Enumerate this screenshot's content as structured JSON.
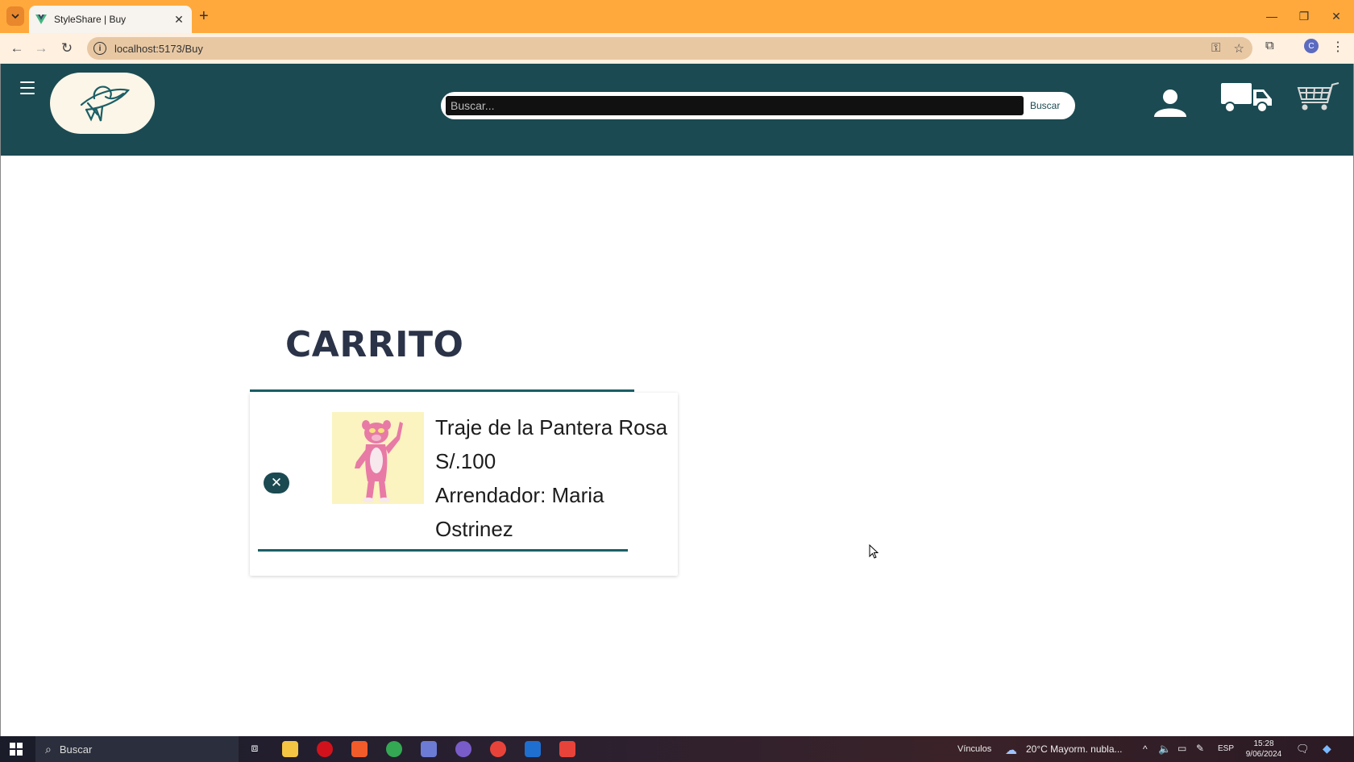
{
  "browser": {
    "tab_title": "StyleShare | Buy",
    "url": "localhost:5173/Buy",
    "profile_initial": "C"
  },
  "header": {
    "search_placeholder": "Buscar...",
    "search_button": "Buscar"
  },
  "cart": {
    "title": "CARRITO",
    "items": [
      {
        "name": "Traje de la Pantera Rosa",
        "price": "S/.100",
        "owner_line": "Arrendador: Maria Ostrinez"
      }
    ]
  },
  "taskbar": {
    "search_label": "Buscar",
    "links_label": "Vínculos",
    "weather": "20°C  Mayorm. nubla...",
    "language": "ESP",
    "time": "15:28",
    "date": "9/06/2024"
  },
  "colors": {
    "header_bg": "#1b4a52",
    "tab_strip": "#ffa93c",
    "accent_rule": "#1b5f66",
    "title_text": "#2a3348"
  }
}
